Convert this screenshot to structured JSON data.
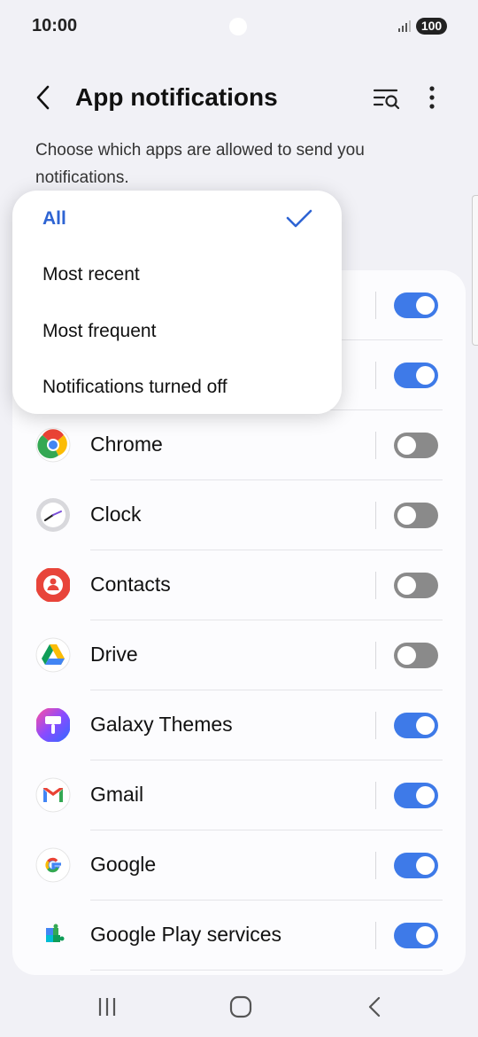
{
  "status": {
    "time": "10:00",
    "battery": "100"
  },
  "header": {
    "title": "App notifications",
    "back_icon": "chevron-left-icon",
    "filter_icon": "filter-search-icon",
    "more_icon": "more-vertical-icon"
  },
  "description": "Choose which apps are allowed to send you notifications.",
  "dropdown": {
    "options": [
      "All",
      "Most recent",
      "Most frequent",
      "Notifications turned off"
    ],
    "selected": "All",
    "check_icon": "checkmark-icon"
  },
  "apps": [
    {
      "label": "",
      "enabled": true
    },
    {
      "label": "",
      "enabled": true
    },
    {
      "label": "Chrome",
      "enabled": false,
      "icon": "chrome-icon"
    },
    {
      "label": "Clock",
      "enabled": false,
      "icon": "clock-icon"
    },
    {
      "label": "Contacts",
      "enabled": false,
      "icon": "contacts-icon"
    },
    {
      "label": "Drive",
      "enabled": false,
      "icon": "drive-icon"
    },
    {
      "label": "Galaxy Themes",
      "enabled": true,
      "icon": "galaxy-themes-icon"
    },
    {
      "label": "Gmail",
      "enabled": true,
      "icon": "gmail-icon"
    },
    {
      "label": "Google",
      "enabled": true,
      "icon": "google-icon"
    },
    {
      "label": "Google Play services",
      "enabled": true,
      "icon": "google-play-services-icon"
    }
  ],
  "nav": {
    "recents_icon": "recents-icon",
    "home_icon": "home-icon",
    "back_icon": "back-icon"
  },
  "colors": {
    "accent": "#3e7ae8",
    "toggle_off": "#8a8a8a",
    "background": "#f1f1f6",
    "selected_option": "#2e64d3"
  }
}
